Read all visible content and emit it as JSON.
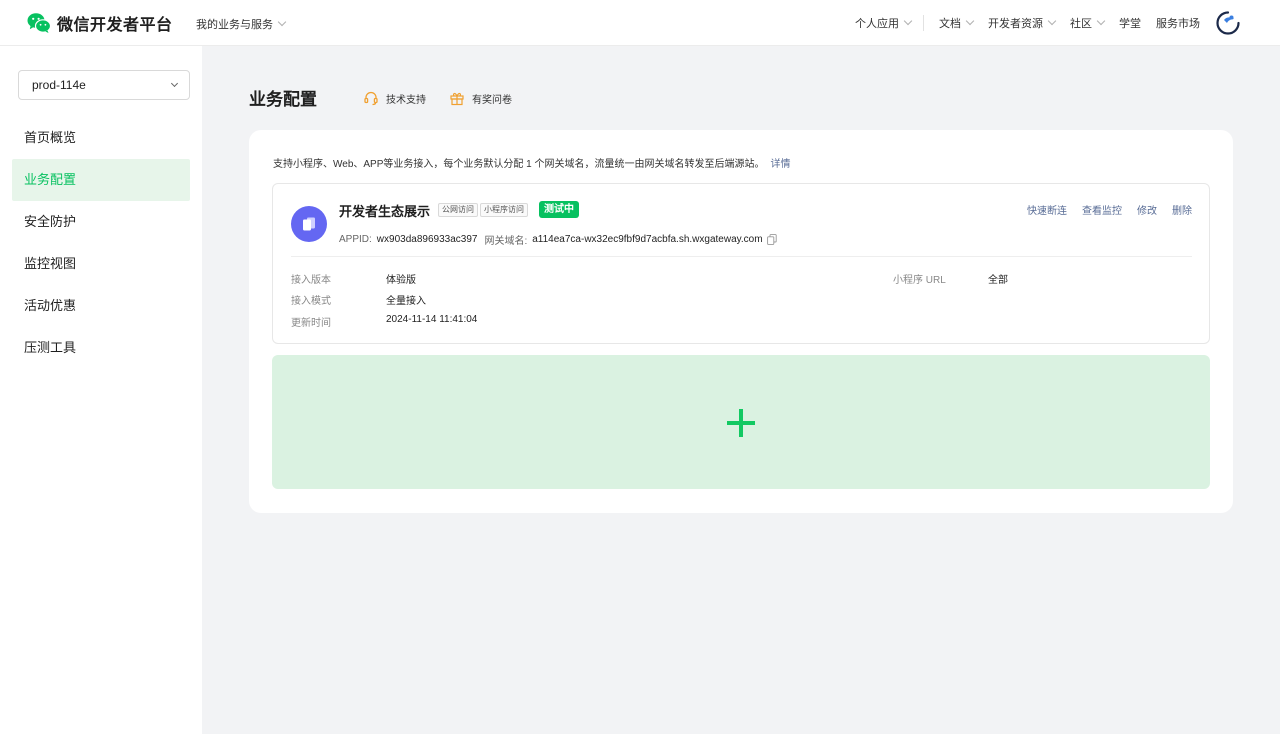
{
  "header": {
    "logo_text": "微信开发者平台",
    "biz_menu": "我的业务与服务",
    "nav": [
      {
        "label": "个人应用",
        "has_dropdown": true
      },
      {
        "label": "文档",
        "has_dropdown": true
      },
      {
        "label": "开发者资源",
        "has_dropdown": true
      },
      {
        "label": "社区",
        "has_dropdown": true
      },
      {
        "label": "学堂",
        "has_dropdown": false
      },
      {
        "label": "服务市场",
        "has_dropdown": false
      }
    ]
  },
  "sidebar": {
    "env_select": "prod-114e",
    "items": [
      {
        "label": "首页概览",
        "active": false
      },
      {
        "label": "业务配置",
        "active": true
      },
      {
        "label": "安全防护",
        "active": false
      },
      {
        "label": "监控视图",
        "active": false
      },
      {
        "label": "活动优惠",
        "active": false
      },
      {
        "label": "压测工具",
        "active": false
      }
    ]
  },
  "main": {
    "title": "业务配置",
    "support_link": "技术支持",
    "survey_link": "有奖问卷",
    "description": "支持小程序、Web、APP等业务接入，每个业务默认分配 1 个网关域名，流量统一由网关域名转发至后端源站。",
    "details_link": "详情",
    "business": {
      "name": "开发者生态展示",
      "tags": [
        "公网访问",
        "小程序访问"
      ],
      "status": "测试中",
      "appid_label": "APPID:",
      "appid": "wx903da896933ac397",
      "domain_label": "网关域名:",
      "domain": "a114ea7ca-wx32ec9fbf9d7acbfa.sh.wxgateway.com",
      "actions": [
        "快速断连",
        "查看监控",
        "修改",
        "删除"
      ],
      "fields": {
        "version_label": "接入版本",
        "version": "体验版",
        "mode_label": "接入模式",
        "mode": "全量接入",
        "updated_label": "更新时间",
        "updated": "2024-11-14 11:41:04",
        "url_label": "小程序 URL",
        "url": "全部"
      }
    }
  },
  "colors": {
    "brand_green": "#07c160",
    "link_blue": "#576b95",
    "icon_purple": "#6467f2",
    "add_tile_bg": "#daf2e1"
  }
}
